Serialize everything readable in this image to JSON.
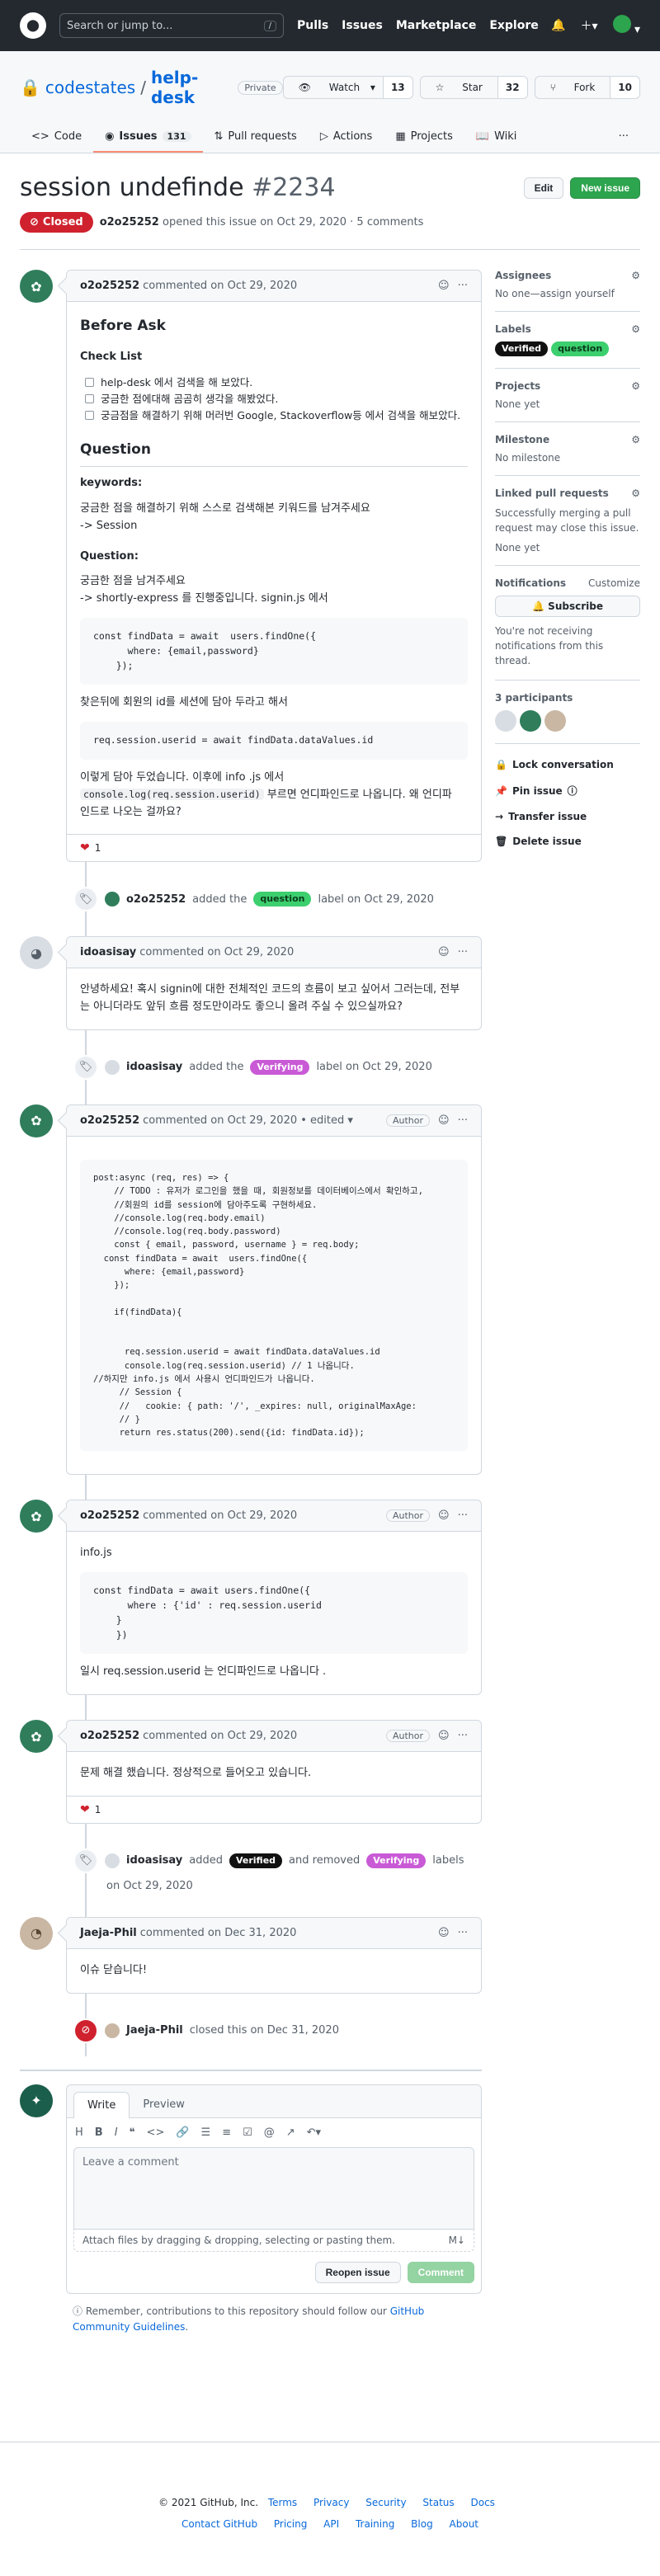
{
  "header": {
    "search_placeholder": "Search or jump to...",
    "search_kbd": "/",
    "nav": [
      "Pulls",
      "Issues",
      "Marketplace",
      "Explore"
    ]
  },
  "repo": {
    "owner": "codestates",
    "name": "help-desk",
    "visibility": "Private",
    "watch_label": "Watch",
    "watch_count": "13",
    "star_label": "Star",
    "star_count": "32",
    "fork_label": "Fork",
    "fork_count": "10",
    "tabs": [
      {
        "label": "Code"
      },
      {
        "label": "Issues",
        "count": "131"
      },
      {
        "label": "Pull requests"
      },
      {
        "label": "Actions"
      },
      {
        "label": "Projects"
      },
      {
        "label": "Wiki"
      }
    ]
  },
  "issue": {
    "title": "session undefinde",
    "number": "#2234",
    "edit_label": "Edit",
    "new_issue_label": "New issue",
    "state": "Closed",
    "author": "o2o25252",
    "opened_text": "opened this issue on Oct 29, 2020 · 5 comments"
  },
  "comments": [
    {
      "author": "o2o25252",
      "meta": "commented on Oct 29, 2020",
      "before_ask": "Before Ask",
      "checklist_title": "Check List",
      "checklist": [
        "help-desk 에서 검색을 해 보았다.",
        "궁금한 점에대해 곰곰히 생각을 해봤었다.",
        "궁금점을 해결하기 위해 머러번 Google, Stackoverflow등 에서 검색을 해보았다."
      ],
      "question_title": "Question",
      "keywords_title": "keywords:",
      "keywords_text": "궁금한 점을 해결하기 위해 스스로 검색해본 키워드를 남겨주세요",
      "keywords_value": "-> Session",
      "question_sub": "Question:",
      "question_text1": "궁금한 점을 남겨주세요",
      "question_text2": "-> shortly-express 를 진행중입니다. signin.js 에서",
      "code1": "const findData = await  users.findOne({\n      where: {email,password}\n    });",
      "after_code": "찾은뒤에 회원의 id를 세션에 담아 두라고 해서",
      "code2": "req.session.userid = await findData.dataValues.id",
      "ending1": "이렇게 담아 두었습니다. 이후에 info .js 에서",
      "ending_code": "console.log(req.session.userid)",
      "ending2": "부르면 언디파인드로 나옵니다. 왜 언디파",
      "ending3": "인드로 나오는 걸까요?",
      "reaction_count": "1"
    },
    {
      "author": "idoasisay",
      "meta": "commented on Oct 29, 2020",
      "body": "안녕하세요! 혹시 signin에 대한 전체적인 코드의 흐름이 보고 싶어서 그러는데, 전부는 아니더라도 앞뒤 흐름 정도만이라도 좋으니 올려 주실 수 있으실까요?"
    },
    {
      "author": "o2o25252",
      "meta": "commented on Oct 29, 2020 • edited",
      "badge": "Author",
      "code": "post:async (req, res) => {\n    // TODO : 유저가 로그인을 했을 때, 회원정보를 데이터베이스에서 확인하고,\n    //회원의 id를 session에 담아주도록 구현하세요.\n    //console.log(req.body.email)\n    //console.log(req.body.password)\n    const { email, password, username } = req.body;\n  const findData = await  users.findOne({\n      where: {email,password}\n    });\n\n    if(findData){\n\n\n      req.session.userid = await findData.dataValues.id\n      console.log(req.session.userid) // 1 나옵니다.\n//하지만 info.js 에서 사용시 언디파인드가 나옵니다.\n     // Session {\n     //   cookie: { path: '/', _expires: null, originalMaxAge:\n     // }\n     return res.status(200).send({id: findData.id});"
    },
    {
      "author": "o2o25252",
      "meta": "commented on Oct 29, 2020",
      "badge": "Author",
      "file": "info.js",
      "code": "const findData = await users.findOne({\n      where : {'id' : req.session.userid\n    }\n    })",
      "body": "일시 req.session.userid 는 언디파인드로 나옵니다 ."
    },
    {
      "author": "o2o25252",
      "meta": "commented on Oct 29, 2020",
      "badge": "Author",
      "body": "문제 해결 했습니다. 정상적으로 들어오고 있습니다.",
      "reaction_count": "1"
    },
    {
      "author": "Jaeja-Phil",
      "meta": "commented on Dec 31, 2020",
      "body": "이슈 닫습니다!"
    }
  ],
  "events": {
    "e1": {
      "actor": "o2o25252",
      "pre": "added the",
      "label": "question",
      "post": "label on Oct 29, 2020"
    },
    "e2": {
      "actor": "idoasisay",
      "pre": "added the",
      "label": "Verifying",
      "post": "label on Oct 29, 2020"
    },
    "e3": {
      "actor": "idoasisay",
      "pre": "added",
      "label1": "Verified",
      "mid": "and removed",
      "label2": "Verifying",
      "post": "labels",
      "date": "on Oct 29, 2020"
    },
    "e4": {
      "actor": "Jaeja-Phil",
      "text": "closed this on Dec 31, 2020"
    }
  },
  "sidebar": {
    "assignees_title": "Assignees",
    "assignees_value": "No one—assign yourself",
    "labels_title": "Labels",
    "labels": [
      "Verified",
      "question"
    ],
    "projects_title": "Projects",
    "projects_value": "None yet",
    "milestone_title": "Milestone",
    "milestone_value": "No milestone",
    "linked_title": "Linked pull requests",
    "linked_text": "Successfully merging a pull request may close this issue.",
    "linked_value": "None yet",
    "notif_title": "Notifications",
    "notif_customize": "Customize",
    "subscribe": "Subscribe",
    "notif_text": "You're not receiving notifications from this thread.",
    "participants": "3 participants",
    "lock": "Lock conversation",
    "pin": "Pin issue",
    "transfer": "Transfer issue",
    "delete": "Delete issue"
  },
  "editor": {
    "tab_write": "Write",
    "tab_preview": "Preview",
    "placeholder": "Leave a comment",
    "attach": "Attach files by dragging & dropping, selecting or pasting them.",
    "reopen": "Reopen issue",
    "comment": "Comment",
    "remember_pre": "Remember, contributions to this repository should follow our",
    "remember_link": "GitHub Community Guidelines",
    "remember_post": "."
  },
  "footer": {
    "copyright": "© 2021 GitHub, Inc.",
    "row1": [
      "Terms",
      "Privacy",
      "Security",
      "Status",
      "Docs"
    ],
    "row2": [
      "Contact GitHub",
      "Pricing",
      "API",
      "Training",
      "Blog",
      "About"
    ]
  }
}
